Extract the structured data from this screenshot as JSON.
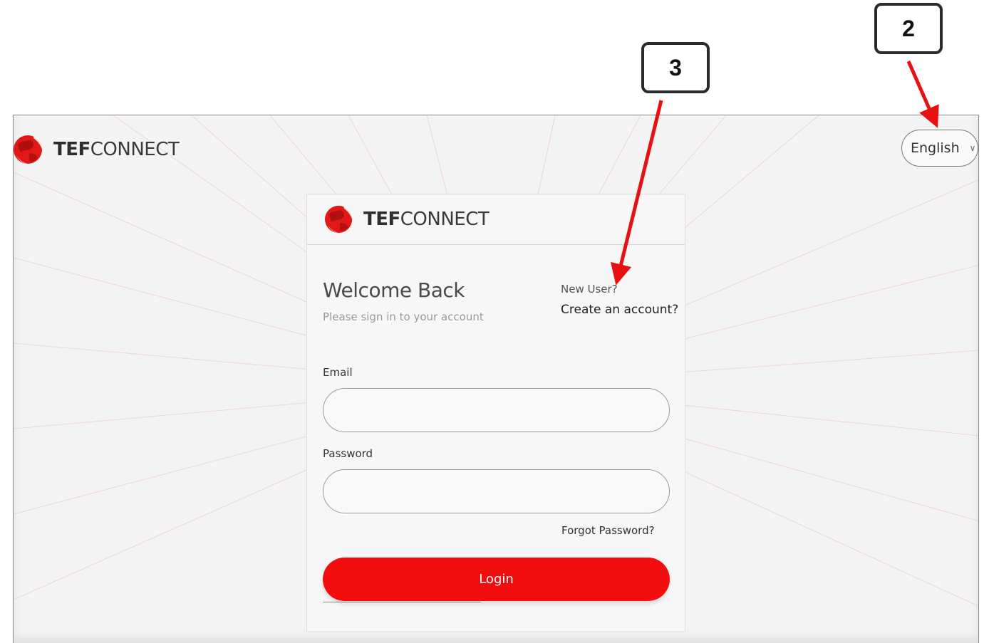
{
  "callouts": {
    "three": "3",
    "two": "2"
  },
  "header": {
    "brand_bold": "TEF",
    "brand_rest": "CONNECT",
    "language": "English"
  },
  "card": {
    "brand_bold": "TEF",
    "brand_rest": "CONNECT",
    "title": "Welcome Back",
    "subtitle": "Please sign in to your account",
    "new_user": "New User?",
    "create_account": "Create an account?",
    "email_label": "Email",
    "email_value": "",
    "password_label": "Password",
    "password_value": "",
    "forgot": "Forgot Password?",
    "login": "Login"
  },
  "colors": {
    "accent": "#f20e0e",
    "arrow": "#e81010",
    "callout_border": "#2b2b2b"
  },
  "icons": {
    "logo": "red-globe-icon",
    "chevron": "chevron-down-icon",
    "arrow": "red-arrow-icon"
  }
}
